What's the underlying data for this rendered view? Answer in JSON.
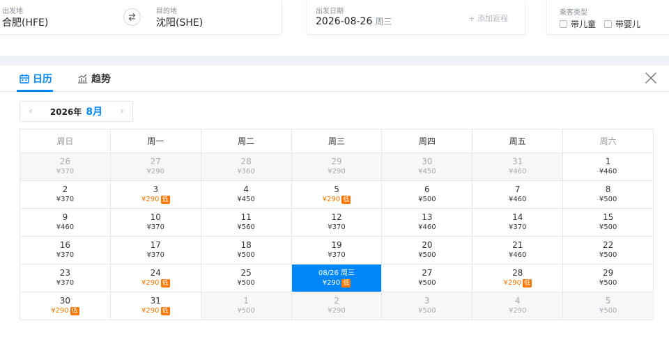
{
  "search": {
    "from_label": "出发地",
    "from_value": "合肥(HFE)",
    "to_label": "目的地",
    "to_value": "沈阳(SHE)",
    "date_label": "出发日期",
    "date_value": "2026-08-26",
    "date_weekday": "周三",
    "add_return": "+ 添加返程",
    "pax_label": "乘客类型",
    "pax_child": "带儿童",
    "pax_infant": "带婴儿"
  },
  "tabs": {
    "calendar": "日历",
    "trend": "趋势"
  },
  "month_picker": {
    "year": "2026年",
    "month": "8月",
    "prev": "‹",
    "next": "›"
  },
  "weekdays": [
    "周日",
    "周一",
    "周二",
    "周三",
    "周四",
    "周五",
    "周六"
  ],
  "weeks": [
    [
      {
        "num": "26",
        "price": "¥370",
        "other": true
      },
      {
        "num": "27",
        "price": "¥290",
        "other": true
      },
      {
        "num": "28",
        "price": "¥360",
        "other": true
      },
      {
        "num": "29",
        "price": "¥290",
        "other": true
      },
      {
        "num": "30",
        "price": "¥450",
        "other": true
      },
      {
        "num": "31",
        "price": "¥460",
        "other": true
      },
      {
        "num": "1",
        "price": "¥460"
      }
    ],
    [
      {
        "num": "2",
        "price": "¥370"
      },
      {
        "num": "3",
        "price": "¥290",
        "low": true
      },
      {
        "num": "4",
        "price": "¥450"
      },
      {
        "num": "5",
        "price": "¥290",
        "low": true
      },
      {
        "num": "6",
        "price": "¥500"
      },
      {
        "num": "7",
        "price": "¥460"
      },
      {
        "num": "8",
        "price": "¥500"
      }
    ],
    [
      {
        "num": "9",
        "price": "¥460"
      },
      {
        "num": "10",
        "price": "¥370"
      },
      {
        "num": "11",
        "price": "¥560"
      },
      {
        "num": "12",
        "price": "¥370"
      },
      {
        "num": "13",
        "price": "¥460"
      },
      {
        "num": "14",
        "price": "¥370"
      },
      {
        "num": "15",
        "price": "¥500"
      }
    ],
    [
      {
        "num": "16",
        "price": "¥370"
      },
      {
        "num": "17",
        "price": "¥370"
      },
      {
        "num": "18",
        "price": "¥500"
      },
      {
        "num": "19",
        "price": "¥370"
      },
      {
        "num": "20",
        "price": "¥500"
      },
      {
        "num": "21",
        "price": "¥460"
      },
      {
        "num": "22",
        "price": "¥500"
      }
    ],
    [
      {
        "num": "23",
        "price": "¥370"
      },
      {
        "num": "24",
        "price": "¥290",
        "low": true
      },
      {
        "num": "25",
        "price": "¥500"
      },
      {
        "num": "08/26 周三",
        "price": "¥290",
        "low": true,
        "selected": true
      },
      {
        "num": "27",
        "price": "¥500"
      },
      {
        "num": "28",
        "price": "¥290",
        "low": true
      },
      {
        "num": "29",
        "price": "¥500"
      }
    ],
    [
      {
        "num": "30",
        "price": "¥290",
        "low": true
      },
      {
        "num": "31",
        "price": "¥290",
        "low": true
      },
      {
        "num": "1",
        "price": "¥500",
        "other": true
      },
      {
        "num": "2",
        "price": "¥290",
        "other": true
      },
      {
        "num": "3",
        "price": "¥500",
        "other": true
      },
      {
        "num": "4",
        "price": "¥290",
        "other": true
      },
      {
        "num": "5",
        "price": "¥500",
        "other": true
      }
    ]
  ],
  "low_badge_text": "低",
  "colors": {
    "accent": "#0086f6",
    "low_price": "#ff7700"
  }
}
